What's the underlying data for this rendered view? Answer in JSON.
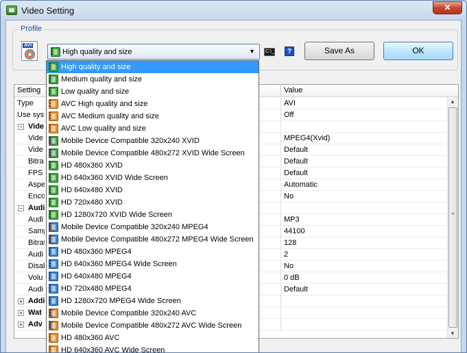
{
  "window": {
    "title": "Video Setting",
    "close_label": "✕"
  },
  "profile": {
    "group_label": "Profile",
    "icon_label": "AVI",
    "selected": "High quality and size",
    "cmd_label": "C:\\_",
    "help_label": "?",
    "save_as_label": "Save As",
    "ok_label": "OK"
  },
  "grid": {
    "col_setting": "Setting",
    "col_value": "Value",
    "rows": [
      {
        "key": "Type",
        "value": "AVI"
      },
      {
        "key": "Use syst",
        "value": "Off"
      },
      {
        "key": "Vide",
        "value": ""
      },
      {
        "key": "Vide",
        "value": "MPEG4(Xvid)"
      },
      {
        "key": "Vide",
        "value": "Default"
      },
      {
        "key": "Bitra",
        "value": "Default"
      },
      {
        "key": "FPS",
        "value": "Default"
      },
      {
        "key": "Aspe",
        "value": "Automatic"
      },
      {
        "key": "Enco",
        "value": "No"
      },
      {
        "key": "Audi",
        "value": ""
      },
      {
        "key": "Audi",
        "value": "MP3"
      },
      {
        "key": "Samp",
        "value": "44100"
      },
      {
        "key": "Bitrat",
        "value": "128"
      },
      {
        "key": "Audi",
        "value": "2"
      },
      {
        "key": "Disab",
        "value": "No"
      },
      {
        "key": "Volu",
        "value": "0 dB"
      },
      {
        "key": "Audi",
        "value": "Default"
      },
      {
        "key": "Addi",
        "value": ""
      },
      {
        "key": "Wat",
        "value": ""
      },
      {
        "key": "Adv",
        "value": ""
      }
    ]
  },
  "dropdown": {
    "items": [
      {
        "label": "High quality and size",
        "color": "green"
      },
      {
        "label": "Medium quality and size",
        "color": "green"
      },
      {
        "label": "Low quality and size",
        "color": "green"
      },
      {
        "label": "AVC High quality and size",
        "color": "orange"
      },
      {
        "label": "AVC Medium quality and size",
        "color": "orange"
      },
      {
        "label": "AVC Low quality and size",
        "color": "orange"
      },
      {
        "label": "Mobile Device Compatible 320x240 XVID",
        "color": "green-phone"
      },
      {
        "label": "Mobile Device Compatible 480x272 XVID Wide Screen",
        "color": "green-phone"
      },
      {
        "label": "HD 480x360 XVID",
        "color": "green"
      },
      {
        "label": "HD 640x360 XVID Wide Screen",
        "color": "green"
      },
      {
        "label": "HD 640x480 XVID",
        "color": "green"
      },
      {
        "label": "HD 720x480 XVID",
        "color": "green"
      },
      {
        "label": "HD 1280x720 XVID Wide Screen",
        "color": "green"
      },
      {
        "label": "Mobile Device Compatible 320x240 MPEG4",
        "color": "blue-phone"
      },
      {
        "label": "Mobile Device Compatible 480x272 MPEG4 Wide Screen",
        "color": "blue-phone"
      },
      {
        "label": "HD 480x360 MPEG4",
        "color": "blue"
      },
      {
        "label": "HD 640x360 MPEG4 Wide Screen",
        "color": "blue"
      },
      {
        "label": "HD 640x480 MPEG4",
        "color": "blue"
      },
      {
        "label": "HD 720x480 MPEG4",
        "color": "blue"
      },
      {
        "label": "HD 1280x720 MPEG4 Wide Screen",
        "color": "blue"
      },
      {
        "label": "Mobile Device Compatible 320x240 AVC",
        "color": "orange-phone"
      },
      {
        "label": "Mobile Device Compatible 480x272 AVC Wide Screen",
        "color": "orange-phone"
      },
      {
        "label": "HD 480x360 AVC",
        "color": "orange"
      },
      {
        "label": "HD 640x360 AVC Wide Screen",
        "color": "orange"
      }
    ]
  }
}
